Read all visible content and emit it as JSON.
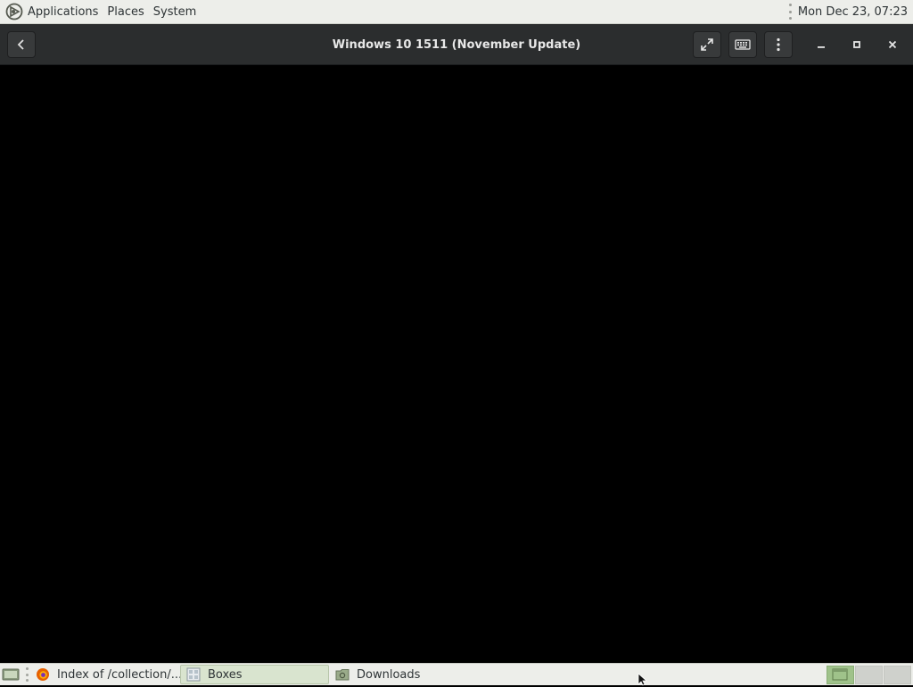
{
  "top_panel": {
    "menus": [
      {
        "label": "Applications",
        "icon": "gnome-foot-icon"
      },
      {
        "label": "Places"
      },
      {
        "label": "System"
      }
    ],
    "clock": "Mon Dec 23, 07:23"
  },
  "headerbar": {
    "title": "Windows 10 1511 (November Update)",
    "buttons": {
      "back": "back-icon",
      "fullscreen": "fullscreen-icon",
      "keyboard": "keyboard-icon",
      "menu": "menu-icon",
      "minimize": "minimize-icon",
      "maximize": "maximize-icon",
      "close": "close-icon"
    }
  },
  "taskbar": {
    "tasks": [
      {
        "label": "Index of /collection/...",
        "icon": "firefox-icon",
        "active": false
      },
      {
        "label": "Boxes",
        "icon": "boxes-icon",
        "active": true
      },
      {
        "label": "Downloads",
        "icon": "folder-icon",
        "active": false
      }
    ],
    "workspaces": [
      {
        "active": true
      },
      {
        "active": false
      },
      {
        "active": false
      }
    ]
  },
  "colors": {
    "panel_bg": "#edeeea",
    "headerbar_bg": "#2b2d2e",
    "vm_bg": "#000000",
    "workspace_active": "#9fc28a"
  }
}
